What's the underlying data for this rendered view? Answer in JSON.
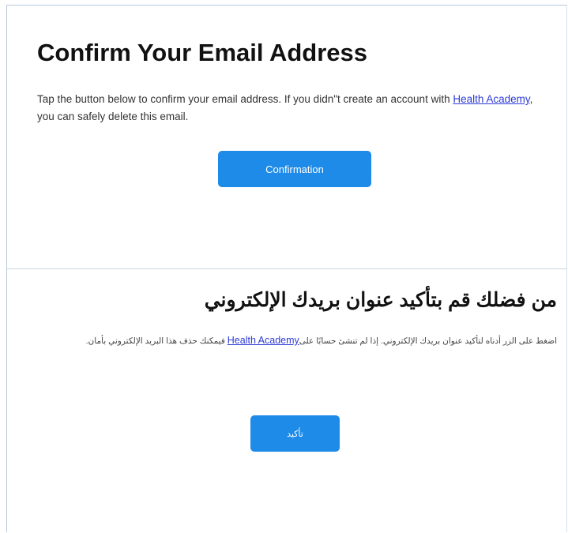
{
  "email_en": {
    "title": "Confirm Your Email Address",
    "body_before_link": "Tap the button below to confirm your email address. If you didn\"t create an account with ",
    "link_text": "Health Academy",
    "body_after_link": ", you can safely delete this email.",
    "button_label": "Confirmation"
  },
  "email_ar": {
    "title": "من فضلك قم بتأكيد عنوان بريدك الإلكتروني",
    "body_before_link": "اضغط على الزر أدناه لتأكيد عنوان بريدك الإلكتروني. إذا لم تنشئ حسابًا على",
    "link_text": "Health Academy",
    "body_after_link": " فيمكنك حذف هذا البريد الإلكتروني بأمان.",
    "button_label": "تأكيد"
  },
  "colors": {
    "button": "#1f8be8",
    "link": "#2d3bd6",
    "border": "#b7c7db"
  }
}
